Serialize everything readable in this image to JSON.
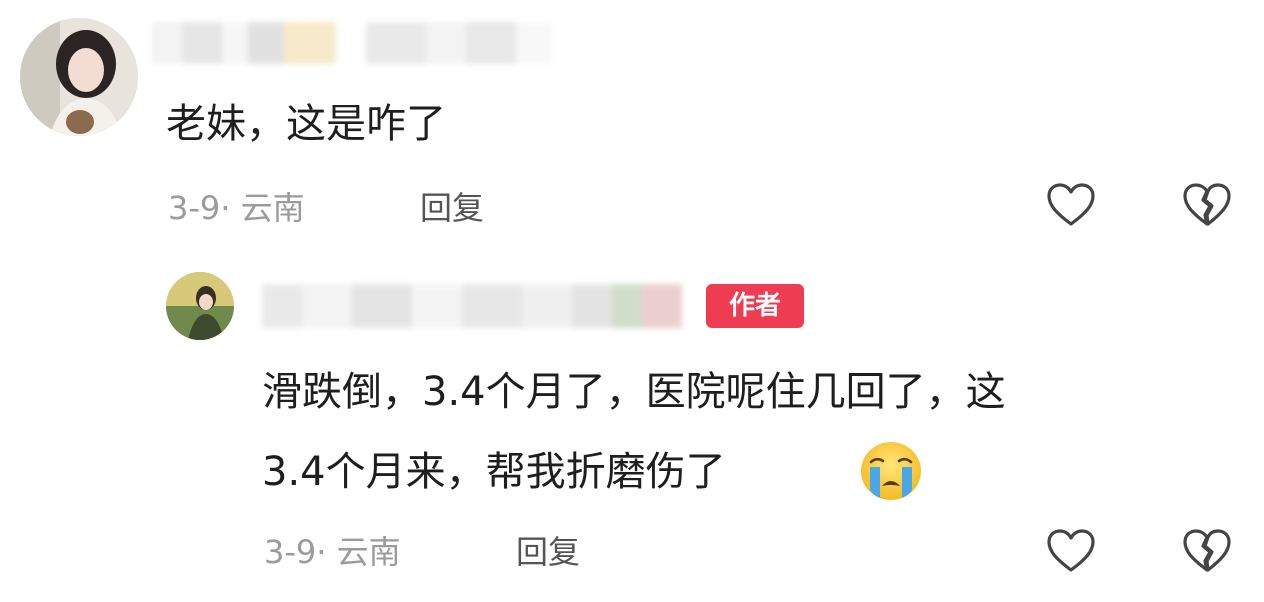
{
  "comments": [
    {
      "text": "老妹，这是咋了",
      "date": "3-9",
      "location": "云南",
      "reply_label": "回复",
      "like_icon": "heart-outline-icon",
      "dislike_icon": "broken-heart-icon"
    },
    {
      "author_badge": "作者",
      "text_line1": "滑跌倒，3.4个月了，医院呢住几回了，这",
      "text_line2": "3.4个月来，帮我折磨伤了",
      "emoji": "crying-face-icon",
      "date": "3-9",
      "location": "云南",
      "reply_label": "回复",
      "like_icon": "heart-outline-icon",
      "dislike_icon": "broken-heart-icon"
    }
  ],
  "colors": {
    "badge": "#ee3d52",
    "meta_text": "#9b9b9b",
    "icon_stroke": "#444444"
  }
}
